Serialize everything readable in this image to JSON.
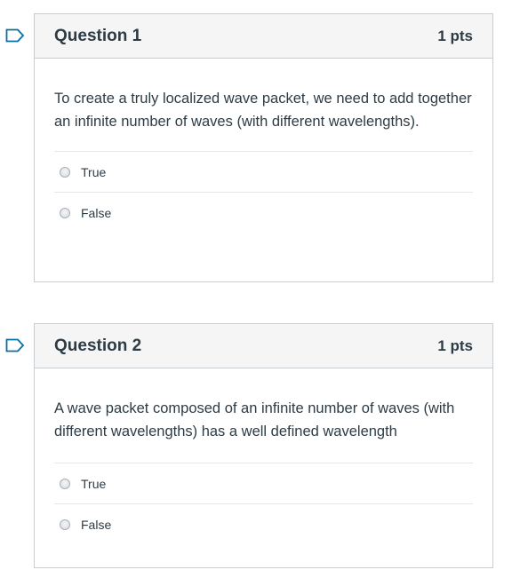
{
  "questions": [
    {
      "title": "Question 1",
      "points": "1 pts",
      "text": "To create a truly localized wave packet, we need to add together an infinite number of waves (with different wavelengths).",
      "answers": [
        {
          "label": "True",
          "selected": false
        },
        {
          "label": "False",
          "selected": false
        }
      ]
    },
    {
      "title": "Question 2",
      "points": "1 pts",
      "text": "A wave packet composed of an infinite number of waves (with different wavelengths) has a well defined wavelength",
      "answers": [
        {
          "label": "True",
          "selected": false
        },
        {
          "label": "False",
          "selected": false
        }
      ]
    }
  ],
  "colors": {
    "accent": "#0770a3",
    "header_bg": "#f5f5f5",
    "border": "#c7cdd1",
    "text": "#2d3b45"
  },
  "icons": {
    "flag": "bookmark-flag-icon",
    "radio": "radio-button-icon"
  }
}
